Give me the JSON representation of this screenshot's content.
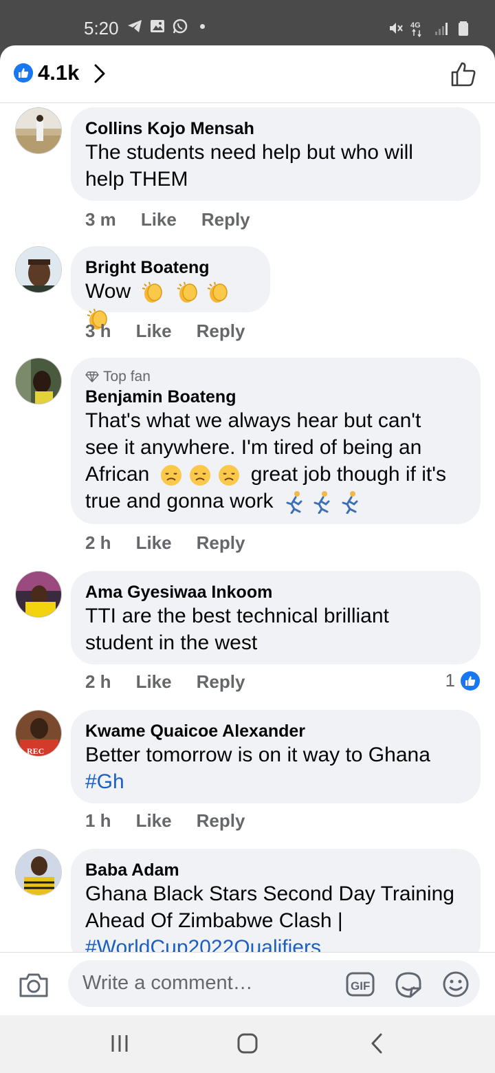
{
  "status_bar": {
    "time": "5:20",
    "icons_left": [
      "telegram-icon",
      "gallery-icon",
      "whatsapp-icon",
      "dot-icon"
    ],
    "icons_right": [
      "mute-icon",
      "4g-icon",
      "signal-icon",
      "battery-icon"
    ],
    "network": "4G"
  },
  "header": {
    "reaction_count": "4.1k"
  },
  "comments": [
    {
      "author": "Collins Kojo Mensah",
      "lines": [
        "The students need help but who will",
        "help THEM"
      ],
      "time": "3 m",
      "like": "Like",
      "reply": "Reply"
    },
    {
      "author": "Bright Boateng",
      "text": "Wow",
      "emoji": [
        "clapping-hands",
        "clapping-hands",
        "clapping-hands",
        "clapping-hands"
      ],
      "time": "3 h",
      "like": "Like",
      "reply": "Reply"
    },
    {
      "badge": "Top fan",
      "author": "Benjamin Boateng",
      "lines": [
        "That's what we always hear but can't",
        "see it anywhere. I'm tired of being an"
      ],
      "line3_before": "African",
      "line3_after": "great job though if it's",
      "line4": "true and gonna work",
      "emoji_disappointed": [
        "disappointed-face",
        "disappointed-face",
        "disappointed-face"
      ],
      "emoji_running": [
        "person-running",
        "person-running",
        "person-running"
      ],
      "time": "2 h",
      "like": "Like",
      "reply": "Reply"
    },
    {
      "author": "Ama Gyesiwaa Inkoom",
      "lines": [
        "TTI are the best technical brilliant",
        "student in the west"
      ],
      "time": "2 h",
      "like": "Like",
      "reply": "Reply",
      "reaction_count": "1"
    },
    {
      "author": "Kwame Quaicoe Alexander",
      "lines": [
        "Better tomorrow is on it way to Ghana"
      ],
      "hashtag": "#Gh",
      "time": "1 h",
      "like": "Like",
      "reply": "Reply"
    },
    {
      "author": "Baba Adam",
      "lines": [
        "Ghana Black Stars Second Day Training",
        "Ahead Of Zimbabwe Clash |"
      ],
      "hashtag": "#WorldCup2022Qualifiers"
    }
  ],
  "composer": {
    "placeholder": "Write a comment…"
  },
  "colors": {
    "brand_blue": "#1877f2",
    "bubble_bg": "#f0f2f5",
    "meta_gray": "#65676b",
    "hashtag_blue": "#1b5fc1"
  }
}
